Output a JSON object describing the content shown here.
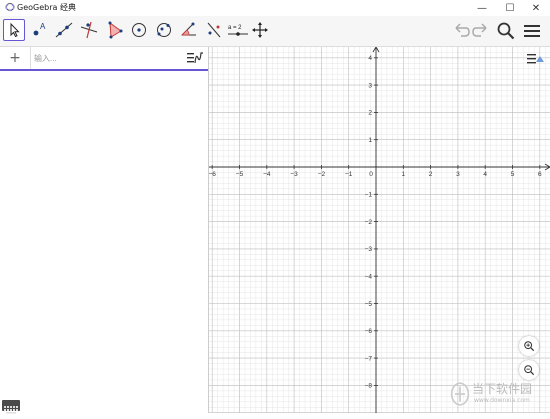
{
  "window": {
    "title": "GeoGebra 经典",
    "minimize_glyph": "—",
    "maximize_glyph": "☐",
    "close_glyph": "✕"
  },
  "toolbar": {
    "tools": [
      {
        "name": "move-tool",
        "icon": "cursor-arrow-icon",
        "selected": true
      },
      {
        "name": "point-tool",
        "icon": "point-icon",
        "label": "A"
      },
      {
        "name": "line-tool",
        "icon": "line-icon"
      },
      {
        "name": "perpendicular-tool",
        "icon": "perpendicular-line-icon"
      },
      {
        "name": "polygon-tool",
        "icon": "polygon-icon"
      },
      {
        "name": "circle-center-point-tool",
        "icon": "circle-icon"
      },
      {
        "name": "conic-tool",
        "icon": "ellipse-icon"
      },
      {
        "name": "angle-tool",
        "icon": "angle-icon"
      },
      {
        "name": "reflect-tool",
        "icon": "reflect-line-icon"
      },
      {
        "name": "slider-tool",
        "icon": "slider-icon",
        "label": "a = 2"
      },
      {
        "name": "move-graphics-view-tool",
        "icon": "move-arrows-icon"
      }
    ],
    "slider_label": "a = 2",
    "point_label": "A"
  },
  "algebra": {
    "plus_label": "+",
    "input_placeholder": "输入..."
  },
  "graphics": {
    "x_ticks": [
      "−6",
      "−5",
      "−4",
      "−3",
      "−2",
      "−1",
      "0",
      "1",
      "2",
      "3",
      "4",
      "5",
      "6"
    ],
    "y_ticks": [
      "4",
      "3",
      "2",
      "1",
      "−1",
      "−2",
      "−3",
      "−4",
      "−5",
      "−6",
      "−7",
      "−8"
    ],
    "grid": true,
    "axis_color": "#333333",
    "grid_major_color": "#c0c0c0",
    "grid_minor_color": "#e6e6e6"
  },
  "colors": {
    "accent": "#6557d2",
    "toolbar_bg": "#f6f6f6",
    "icon_blue": "#1e3d7b",
    "icon_red": "#c23a3a"
  },
  "watermark": {
    "text": "当下软件园",
    "sub": "www.downxia.com"
  }
}
